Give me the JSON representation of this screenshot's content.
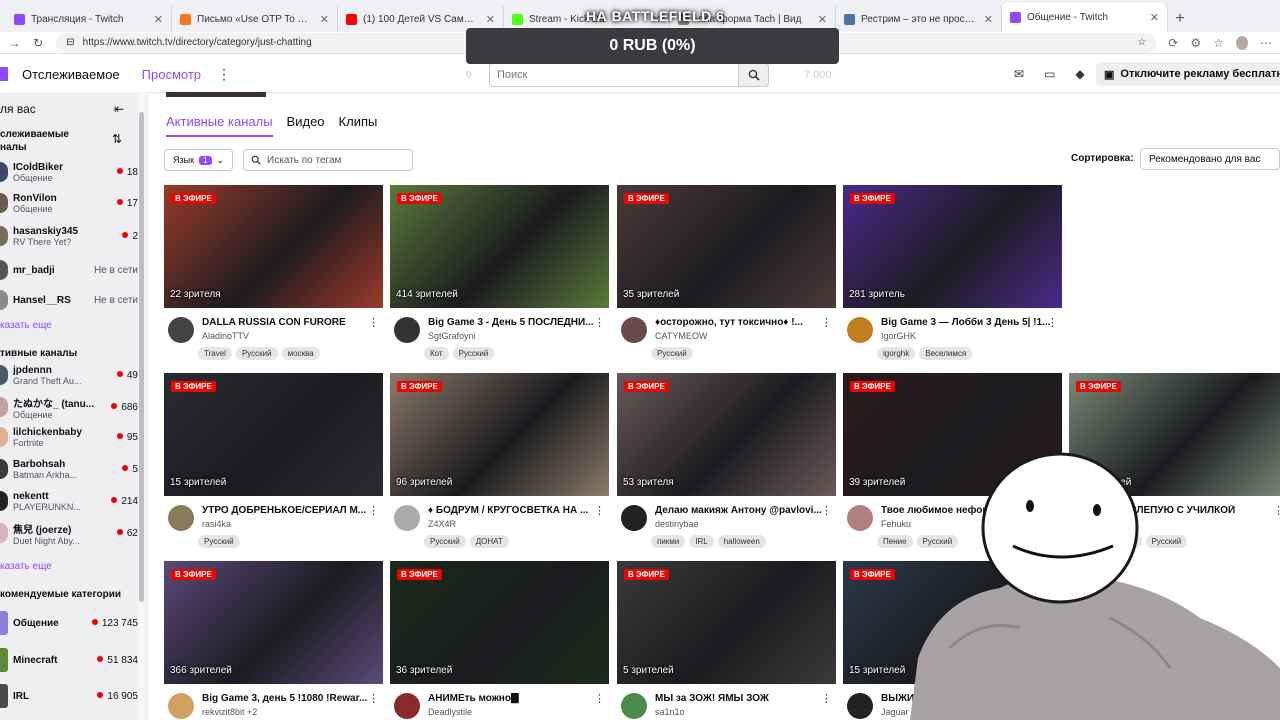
{
  "browser": {
    "tabs": [
      {
        "label": "Трансляция - Twitch",
        "color": "#9147ff"
      },
      {
        "label": "Письмо «Use OTP To Proceed» -",
        "color": "#f6761d"
      },
      {
        "label": "(1) 100 Детей VS Самый Сильн",
        "color": "#ff0000"
      },
      {
        "label": "Stream - Kick Da",
        "color": "#53fc18"
      },
      {
        "label": "-платформа Tach | Вид",
        "color": "#888888"
      },
      {
        "label": "Рестрим – это не просто способ",
        "color": "#4c75a3"
      },
      {
        "label": "Общение - Twitch",
        "color": "#9147ff"
      }
    ],
    "url": "https://www.twitch.tv/directory/category/just-chatting"
  },
  "overlay": {
    "title": "НА BATTLEFIELD 6",
    "donation": "0 RUB (0%)"
  },
  "topnav": {
    "following": "Отслеживаемое",
    "browse": "Просмотр",
    "search_placeholder": "Поиск",
    "ghost_left": "0",
    "ghost_right": "7 000",
    "adfree": "Отключите рекламу бесплатно"
  },
  "sidebar": {
    "header": "ля вас",
    "followed_title": "слеживаемые\nналы",
    "followed": [
      {
        "name": "IColdBiker",
        "game": "Общение",
        "viewers": "18",
        "color": "#3b4a6b"
      },
      {
        "name": "RonVilon",
        "game": "Общение",
        "viewers": "17",
        "color": "#6b5a4a"
      },
      {
        "name": "hasanskiy345",
        "game": "RV There Yet?",
        "viewers": "2",
        "color": "#7a6a5a"
      },
      {
        "name": "mr_badji",
        "game": "",
        "offline": "Не в сети",
        "color": "#555555"
      },
      {
        "name": "Hansel__RS",
        "game": "",
        "offline": "Не в сети",
        "color": "#8a8a8a"
      }
    ],
    "show_more": "казать еще",
    "active_title": "тивные каналы",
    "active": [
      {
        "name": "jpdennn",
        "game": "Grand Theft Au...",
        "viewers": "49",
        "color": "#4a5a6a"
      },
      {
        "name": "たぬかな_ (tanu...",
        "game": "Общение",
        "viewers": "686",
        "color": "#c9a0a0"
      },
      {
        "name": "lilchickenbaby",
        "game": "Fortnite",
        "viewers": "95",
        "color": "#e0b090"
      },
      {
        "name": "Barbohsah",
        "game": "Batman Arkha...",
        "viewers": "5",
        "color": "#3a3a3a"
      },
      {
        "name": "nekentt",
        "game": "PLAYERUNKN...",
        "viewers": "214",
        "color": "#222222"
      },
      {
        "name": "焦兒 (joerze)",
        "game": "Duet Night Aby...",
        "viewers": "62",
        "color": "#d9b0c0"
      }
    ],
    "show_more2": "казать еще",
    "rec_title": "комендуемые категории",
    "categories": [
      {
        "name": "Общение",
        "viewers": "123 745",
        "color": "#8a7fd9"
      },
      {
        "name": "Minecraft",
        "viewers": "51 834",
        "color": "#5a8a3a"
      },
      {
        "name": "IRL",
        "viewers": "16 905",
        "color": "#4a4a4a"
      }
    ]
  },
  "content": {
    "tabs": [
      "Активные каналы",
      "Видео",
      "Клипы"
    ],
    "language_label": "Язык",
    "language_count": "1",
    "tag_placeholder": "Искать по тегам",
    "sort_label": "Сортировка:",
    "sort_value": "Рекомендовано для вас",
    "live_label": "В ЭФИРЕ",
    "streams": [
      {
        "viewers": "22 зрителя",
        "title": "DALLA RUSSIA CON FURORE",
        "channel": "AladinoTTV",
        "tags": [
          "Travel",
          "Русский",
          "москва"
        ],
        "thumb": "#9a3a2a",
        "avatar": "#444444"
      },
      {
        "viewers": "414 зрителей",
        "title": "Big Game 3 - День 5 ПОСЛЕДНИ...",
        "channel": "SgtGrafoyni",
        "tags": [
          "Кот",
          "Русский"
        ],
        "thumb": "#5a7a3a",
        "avatar": "#333333"
      },
      {
        "viewers": "35 зрителей",
        "title": "♦осторожно, тут токсично♦ !...",
        "channel": "CATYMEOW",
        "tags": [
          "Русский"
        ],
        "thumb": "#4a3a3a",
        "avatar": "#6a4a4a"
      },
      {
        "viewers": "281 зритель",
        "title": "Big Game 3 — Лобби 3 День 5| !1...",
        "channel": "IgorGHK",
        "tags": [
          "igorghk",
          "Веселимся"
        ],
        "thumb": "#4a2a8a",
        "avatar": "#c08020"
      },
      {
        "viewers": "15 зрителей",
        "title": "УТРО ДОБРЕНЬКОЕ/СЕРИАЛ М...",
        "channel": "rasi4ka",
        "tags": [
          "Русский"
        ],
        "thumb": "#2a2a30",
        "avatar": "#8a7a5a"
      },
      {
        "viewers": "96 зрителей",
        "title": "♦ БОДРУМ / КРУГОСВЕТКА НА ...",
        "channel": "Z4X4R",
        "tags": [
          "Русский",
          "ДОНАТ"
        ],
        "thumb": "#8a7a6a",
        "avatar": "#aaaaaa"
      },
      {
        "viewers": "53 зрителя",
        "title": "Делаю макияж Антону @pavlovi...",
        "channel": "destinybae",
        "tags": [
          "пикми",
          "IRL",
          "halloween"
        ],
        "thumb": "#6a5a5a",
        "avatar": "#222222"
      },
      {
        "viewers": "39 зрителей",
        "title": "Твое любимое нефор",
        "channel": "Fehuku",
        "tags": [
          "Пение",
          "Русский"
        ],
        "thumb": "#2a1a1a",
        "avatar": "#b08080"
      },
      {
        "viewers": "15 зрителей",
        "title": "НГ ВСЛЕПУЮ С УЧИЛКОЙ",
        "channel": "dd",
        "tags": [
          "Видекс",
          "Русский"
        ],
        "thumb": "#7a8a7a",
        "avatar": "#555555"
      },
      {
        "viewers": "366 зрителей",
        "title": "Big Game 3, день 5 !1080 !Rewar...",
        "channel": "rekvizit8bit +2",
        "tags": [],
        "thumb": "#5a4a7a",
        "avatar": "#d0a060"
      },
      {
        "viewers": "36 зрителей",
        "title": "АНИМЕть можно🀫",
        "channel": "Deadlystile",
        "tags": [],
        "thumb": "#1a2a1a",
        "avatar": "#8a2a2a"
      },
      {
        "viewers": "5 зрителей",
        "title": "МЫ за ЗОЖ! ЯМЫ ЗОЖ",
        "channel": "sa1n1o",
        "tags": [],
        "thumb": "#3a3a3a",
        "avatar": "#4a8a4a"
      },
      {
        "viewers": "15 зрителей",
        "title": "ВЫЖИ",
        "channel": "Jaguar",
        "tags": [],
        "thumb": "#2a3a4a",
        "avatar": "#222222"
      }
    ]
  }
}
